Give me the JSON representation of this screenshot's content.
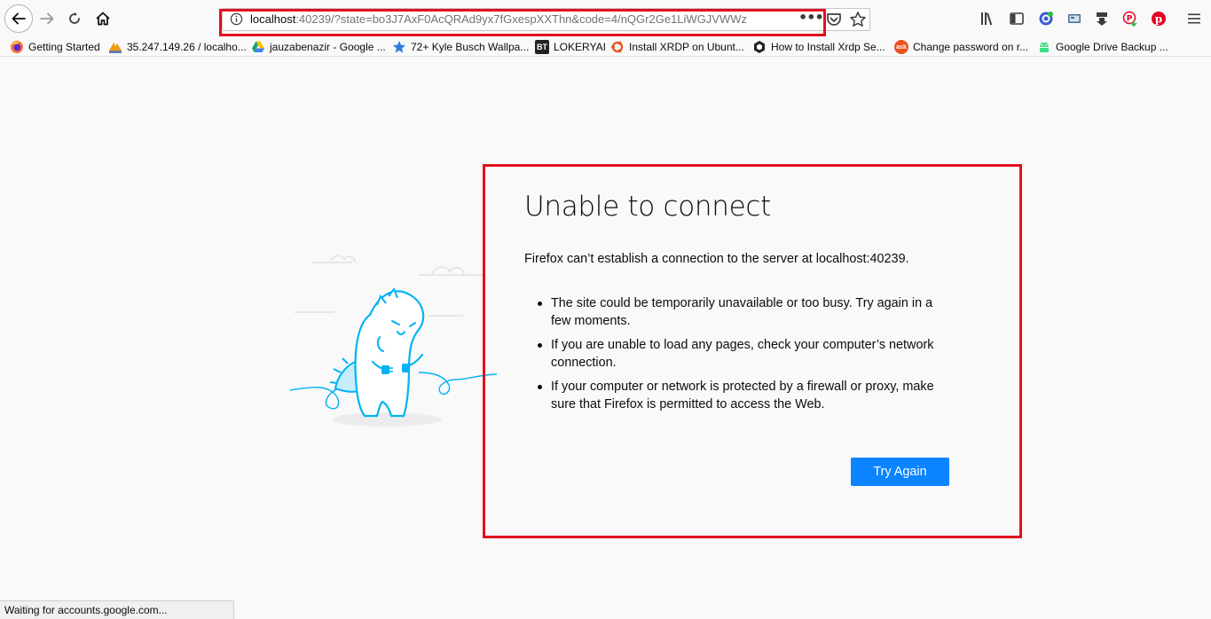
{
  "toolbar": {
    "url_host": "localhost",
    "url_rest": ":40239/?state=bo3J7AxF0AcQRAd9yx7fGxespXXThn&code=4/nQGr2Ge1LiWGJVWWz",
    "more_dots": "•••"
  },
  "bookmarks": [
    {
      "label": "Getting Started",
      "icon": "firefox-icon"
    },
    {
      "label": "35.247.149.26 / localho...",
      "icon": "phpmyadmin-icon"
    },
    {
      "label": "jauzabenazir - Google ...",
      "icon": "google-drive-icon"
    },
    {
      "label": "72+ Kyle Busch Wallpa...",
      "icon": "star-icon"
    },
    {
      "label": "LOKERYAI",
      "icon": "bt-icon",
      "icon_text": "BT"
    },
    {
      "label": "Install XRDP on Ubunt...",
      "icon": "ubuntu-icon"
    },
    {
      "label": "How to Install Xrdp Se...",
      "icon": "hexagon-icon"
    },
    {
      "label": "Change password on r...",
      "icon": "ask-icon",
      "icon_text": "ask"
    },
    {
      "label": "Google Drive Backup ...",
      "icon": "android-icon"
    }
  ],
  "error": {
    "title": "Unable to connect",
    "description": "Firefox can’t establish a connection to the server at localhost:40239.",
    "items": [
      "The site could be temporarily unavailable or too busy. Try again in a few moments.",
      "If you are unable to load any pages, check your computer’s network connection.",
      "If your computer or network is protected by a firewall or proxy, make sure that Firefox is permitted to access the Web."
    ],
    "button": "Try Again"
  },
  "status": "Waiting for accounts.google.com...",
  "colors": {
    "highlight": "#e3101d",
    "accent": "#0a84ff",
    "illustration": "#00b3f4"
  }
}
